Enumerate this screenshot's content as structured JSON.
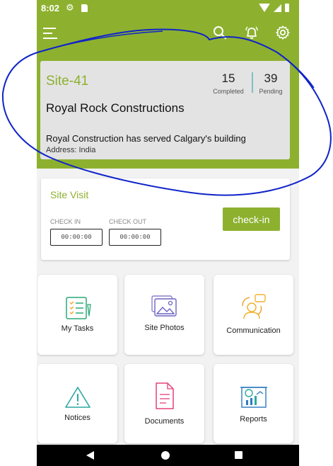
{
  "status": {
    "time": "8:02"
  },
  "site": {
    "id": "Site-41",
    "completed_count": "15",
    "completed_label": "Completed",
    "pending_count": "39",
    "pending_label": "Pending",
    "name": "Royal Rock Constructions",
    "description": "Royal Construction has served Calgary's building",
    "address_label": "Address:",
    "address_value": "India"
  },
  "visit": {
    "title": "Site Visit",
    "check_in_label": "CHECK IN",
    "check_in_value": "00:00:00",
    "check_out_label": "CHECK OUT",
    "check_out_value": "00:00:00",
    "button_label": "check-in"
  },
  "tiles": [
    {
      "label": "My Tasks",
      "icon": "tasks-icon"
    },
    {
      "label": "Site Photos",
      "icon": "photos-icon"
    },
    {
      "label": "Communication",
      "icon": "communication-icon"
    },
    {
      "label": "Notices",
      "icon": "warning-icon"
    },
    {
      "label": "Documents",
      "icon": "documents-icon"
    },
    {
      "label": "Reports",
      "icon": "reports-icon"
    }
  ],
  "colors": {
    "brand": "#8db12f",
    "annotation": "#1024c8",
    "card_bg": "#e3e3e3",
    "divider": "#7fc0c4"
  }
}
